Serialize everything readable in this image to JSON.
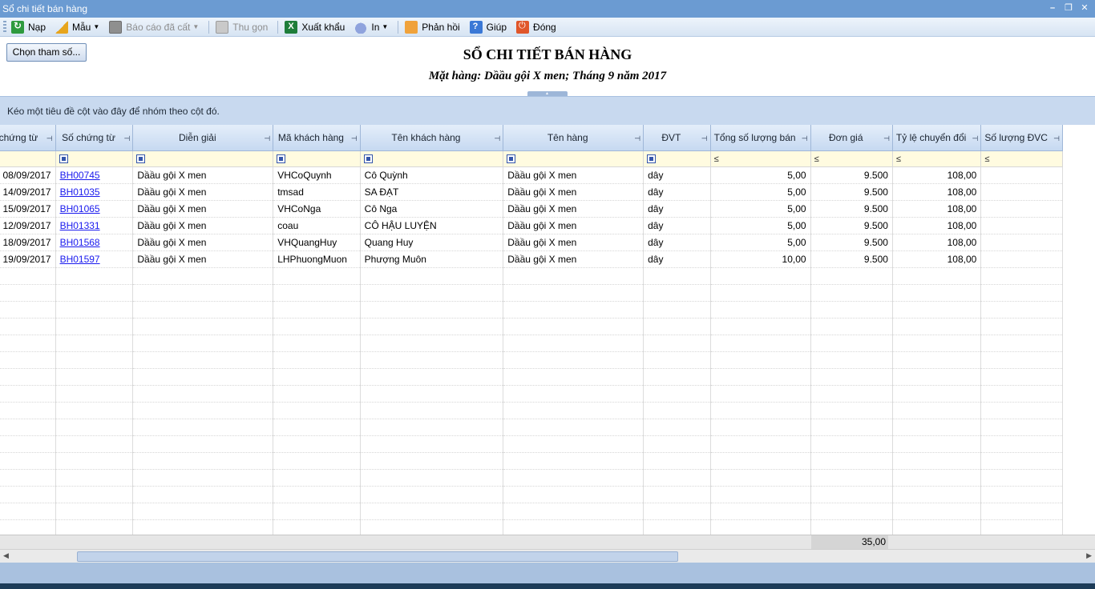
{
  "window": {
    "title": "Sổ chi tiết bán hàng"
  },
  "toolbar": {
    "reload": "Nạp",
    "template": "Mẫu",
    "saved_reports": "Báo cáo đã cất",
    "collapse": "Thu gọn",
    "export": "Xuất khẩu",
    "print": "In",
    "feedback": "Phản hồi",
    "help": "Giúp",
    "close": "Đóng"
  },
  "params_button": {
    "label": "Chọn tham số..."
  },
  "report": {
    "title": "SỔ CHI TIẾT BÁN HÀNG",
    "subtitle": "Mặt hàng: Dầầu gội X men; Tháng 9 năm 2017"
  },
  "group_panel": {
    "hint": "Kéo một tiêu đề cột vào đây để nhóm theo cột đó."
  },
  "grid": {
    "columns": [
      "Ngày chứng từ",
      "Số chứng từ",
      "Diễn giải",
      "Mã khách hàng",
      "Tên khách hàng",
      "Tên hàng",
      "ĐVT",
      "Tổng số lượng bán",
      "Đơn giá",
      "Tỷ lệ chuyển đổi",
      "Số lượng ĐVC"
    ],
    "filter_le": "≤",
    "rows": [
      {
        "date": "08/09/2017",
        "doc": "BH00745",
        "desc": "Dầầu gội X men",
        "cust_code": "VHCoQuynh",
        "cust_name": "Cô Quỳnh",
        "item": "Dầầu gội X men",
        "unit": "dây",
        "qty": "5,00",
        "price": "9.500",
        "ratio": "108,00"
      },
      {
        "date": "14/09/2017",
        "doc": "BH01035",
        "desc": "Dầầu gội X men",
        "cust_code": "tmsad",
        "cust_name": "SA ĐẠT",
        "item": "Dầầu gội X men",
        "unit": "dây",
        "qty": "5,00",
        "price": "9.500",
        "ratio": "108,00"
      },
      {
        "date": "15/09/2017",
        "doc": "BH01065",
        "desc": "Dầầu gội X men",
        "cust_code": "VHCoNga",
        "cust_name": "Cô Nga",
        "item": "Dầầu gội X men",
        "unit": "dây",
        "qty": "5,00",
        "price": "9.500",
        "ratio": "108,00"
      },
      {
        "date": "12/09/2017",
        "doc": "BH01331",
        "desc": "Dầầu gội X men",
        "cust_code": "coau",
        "cust_name": "CÔ HẬU LUYỆN",
        "item": "Dầầu gội X men",
        "unit": "dây",
        "qty": "5,00",
        "price": "9.500",
        "ratio": "108,00"
      },
      {
        "date": "18/09/2017",
        "doc": "BH01568",
        "desc": "Dầầu gội X men",
        "cust_code": "VHQuangHuy",
        "cust_name": "Quang Huy",
        "item": "Dầầu gội X men",
        "unit": "dây",
        "qty": "5,00",
        "price": "9.500",
        "ratio": "108,00"
      },
      {
        "date": "19/09/2017",
        "doc": "BH01597",
        "desc": "Dầầu gội X men",
        "cust_code": "LHPhuongMuon",
        "cust_name": "Phượng Muôn",
        "item": "Dầầu gội X men",
        "unit": "dây",
        "qty": "10,00",
        "price": "9.500",
        "ratio": "108,00"
      }
    ],
    "total_qty": "35,00"
  }
}
